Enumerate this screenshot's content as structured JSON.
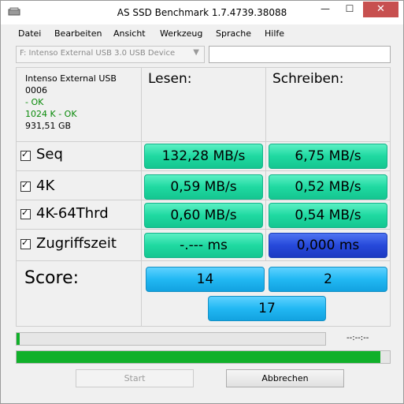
{
  "window": {
    "title": "AS SSD Benchmark 1.7.4739.38088"
  },
  "menu": [
    "Datei",
    "Bearbeiten",
    "Ansicht",
    "Werkzeug",
    "Sprache",
    "Hilfe"
  ],
  "drive": {
    "selected": "F: Intenso External USB 3.0 USB Device",
    "text_value": ""
  },
  "info": {
    "name": "Intenso External USB",
    "firmware": "0006",
    "status1": " - OK",
    "status2": "1024 K - OK",
    "size": "931,51 GB"
  },
  "columns": {
    "read": "Lesen:",
    "write": "Schreiben:"
  },
  "rows": [
    {
      "label": "Seq",
      "checked": true,
      "read": "132,28 MB/s",
      "write": "6,75 MB/s"
    },
    {
      "label": "4K",
      "checked": true,
      "read": "0,59 MB/s",
      "write": "0,52 MB/s"
    },
    {
      "label": "4K-64Thrd",
      "checked": true,
      "read": "0,60 MB/s",
      "write": "0,54 MB/s"
    },
    {
      "label": "Zugriffszeit",
      "checked": true,
      "read": "-.--- ms",
      "write": "0,000 ms"
    }
  ],
  "score": {
    "label": "Score:",
    "read": "14",
    "write": "2",
    "total": "17"
  },
  "progress": {
    "small": 0.01,
    "big": 0.975,
    "time": "--:--:--"
  },
  "buttons": {
    "start": "Start",
    "cancel": "Abbrechen"
  },
  "colors": {
    "value_green": "#1fd9a1",
    "value_blue": "#2649da",
    "score_cyan": "#22b8f3",
    "progress_green": "#11b02a",
    "close_red": "#c7504f"
  }
}
